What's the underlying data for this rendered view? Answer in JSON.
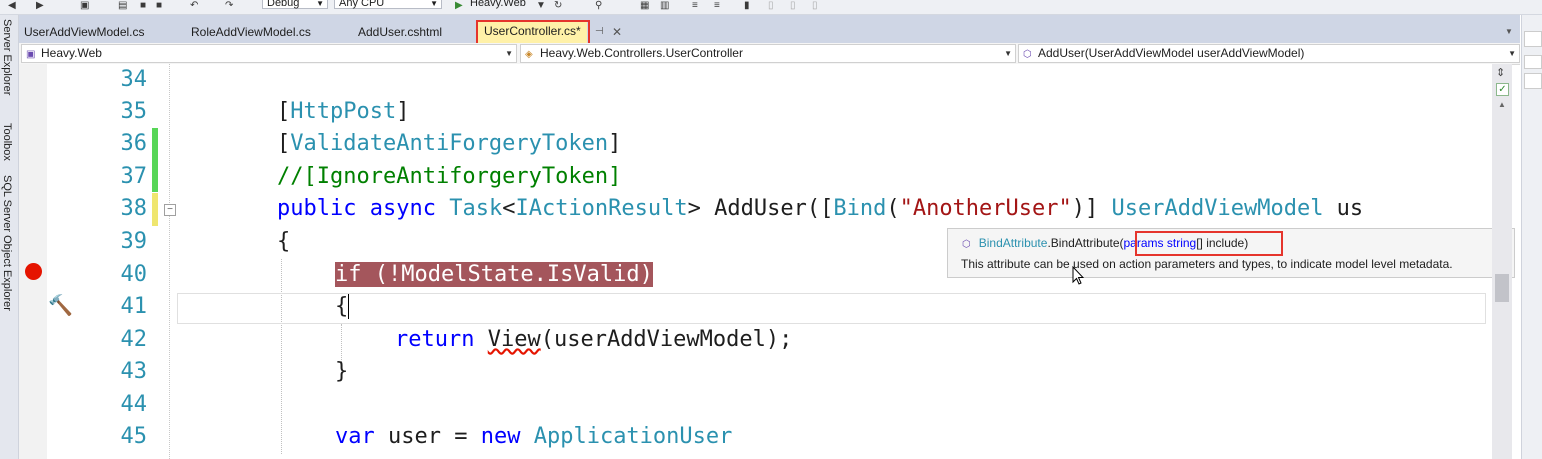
{
  "toolbar": {
    "configuration": "Debug",
    "platform": "Any CPU",
    "start_label": "Heavy.Web"
  },
  "side_tabs": [
    "Server Explorer",
    "Toolbox",
    "SQL Server Object Explorer"
  ],
  "tabs": [
    {
      "label": "UserAddViewModel.cs"
    },
    {
      "label": "RoleAddViewModel.cs"
    },
    {
      "label": "AddUser.cshtml"
    },
    {
      "label": "UserController.cs*"
    }
  ],
  "nav": {
    "project": "Heavy.Web",
    "type": "Heavy.Web.Controllers.UserController",
    "member": "AddUser(UserAddViewModel userAddViewModel)"
  },
  "line_numbers": [
    "34",
    "35",
    "36",
    "37",
    "38",
    "39",
    "40",
    "41",
    "42",
    "43",
    "44",
    "45"
  ],
  "code": {
    "l35_open": "[",
    "l35_name": "HttpPost",
    "l35_close": "]",
    "l36_open": "[",
    "l36_name": "ValidateAntiForgeryToken",
    "l36_close": "]",
    "l37": "//[IgnoreAntiforgeryToken]",
    "l38_public": "public",
    "l38_async": "async",
    "l38_task": "Task",
    "l38_lt": "<",
    "l38_iaction": "IActionResult",
    "l38_gt": "> AddUser([",
    "l38_bind": "Bind",
    "l38_paren": "(",
    "l38_str": "\"AnotherUser\"",
    "l38_close": ")] ",
    "l38_vm": "UserAddViewModel",
    "l38_param": " us",
    "l39": "{",
    "l40": "if (!ModelState.IsValid)",
    "l41": "{",
    "l42_return": "return",
    "l42_view": "View",
    "l42_rest": "(userAddViewModel);",
    "l43": "}",
    "l45_var": "var",
    "l45_user": " user = ",
    "l45_new": "new",
    "l45_type": "ApplicationUser"
  },
  "tooltip": {
    "class_name": "BindAttribute",
    "method": ".BindAttribute",
    "open": "(",
    "params_kw": "params",
    "string_kw": "string",
    "rest": "[] include)",
    "description": "This attribute can be used on action parameters and types, to indicate model level metadata."
  }
}
